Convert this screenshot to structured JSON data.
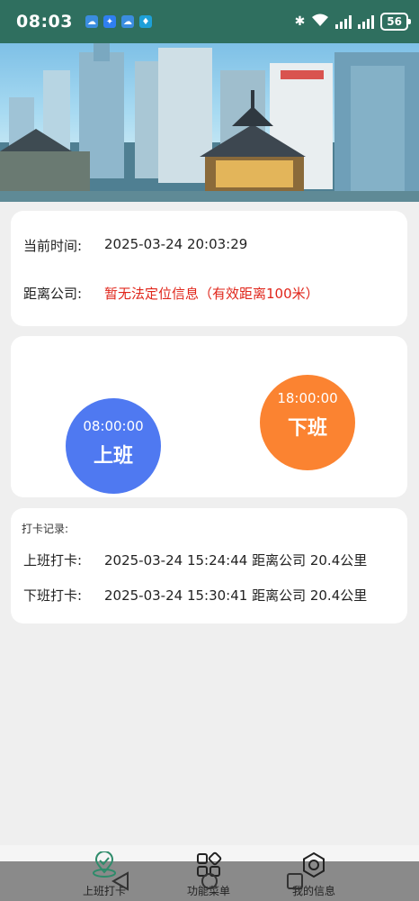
{
  "status_bar": {
    "time": "08:03",
    "battery": "56"
  },
  "info": {
    "current_time_label": "当前时间:",
    "current_time_value": "2025-03-24 20:03:29",
    "distance_label": "距离公司:",
    "distance_value": "暂无法定位信息（有效距离100米）"
  },
  "buttons": {
    "clock_in": {
      "time": "08:00:00",
      "label": "上班"
    },
    "clock_out": {
      "time": "18:00:00",
      "label": "下班"
    }
  },
  "records": {
    "title": "打卡记录:",
    "rows": [
      {
        "label": "上班打卡:",
        "value": "2025-03-24 15:24:44 距离公司 20.4公里"
      },
      {
        "label": "下班打卡:",
        "value": "2025-03-24 15:30:41 距离公司 20.4公里"
      }
    ]
  },
  "tabs": [
    {
      "label": "上班打卡",
      "icon": "location-check-icon",
      "active": true
    },
    {
      "label": "功能菜单",
      "icon": "grid-menu-icon",
      "active": false
    },
    {
      "label": "我的信息",
      "icon": "gear-icon",
      "active": false
    }
  ],
  "colors": {
    "status_bar": "#2f6f5f",
    "clock_in": "#4f79f1",
    "clock_out": "#fb8331",
    "warning": "#e0261b",
    "active_tab_icon": "#2e8b6a"
  }
}
